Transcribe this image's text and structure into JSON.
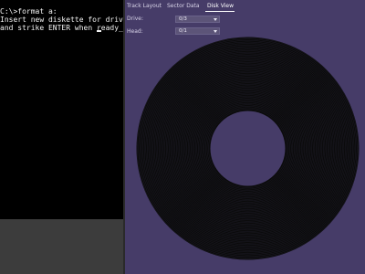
{
  "terminal": {
    "lines": [
      "C:\\>format a:",
      "Insert new diskette for drive A:",
      "and strike ENTER when ready_"
    ]
  },
  "panel": {
    "tabs": [
      "Track Layout",
      "Sector Data",
      "Disk View"
    ],
    "active_tab": "Disk View",
    "drive_label": "Drive:",
    "drive_value": "0/3",
    "head_label": "Head:",
    "head_value": "0/1"
  },
  "icons": {
    "drive_select": "chevron-down-icon",
    "head_select": "chevron-down-icon"
  },
  "colors": {
    "panel_background": "#463c68",
    "disk_surface": "#0a0a0a",
    "terminal_background": "#000000",
    "terminal_text": "#f2f2f2"
  }
}
